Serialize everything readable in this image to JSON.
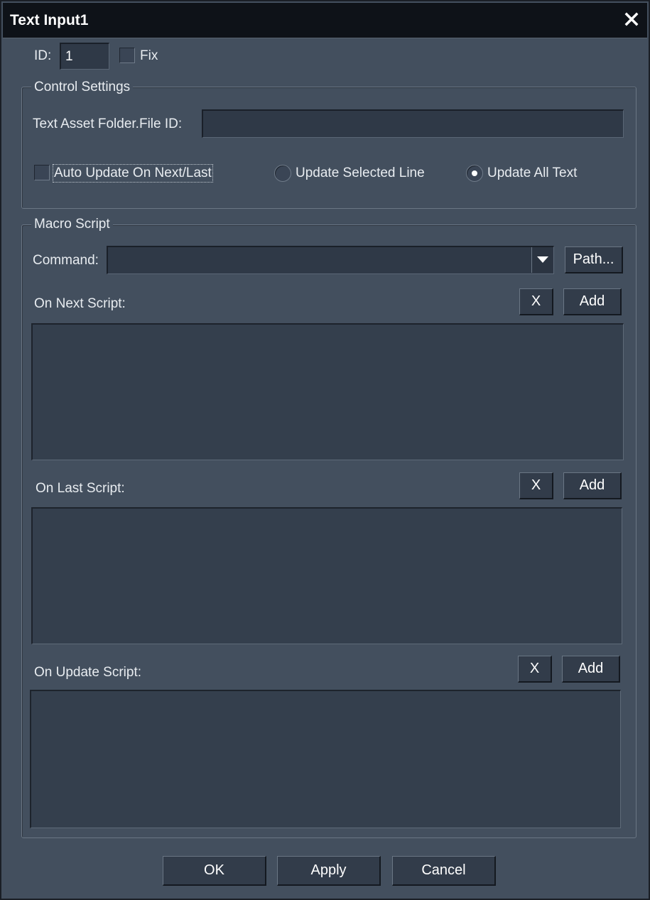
{
  "window": {
    "title": "Text Input1",
    "close_icon": "close-icon"
  },
  "id_row": {
    "id_label": "ID:",
    "id_value": "1",
    "fix_label": "Fix",
    "fix_checked": false
  },
  "control_settings": {
    "title": "Control Settings",
    "asset_label": "Text Asset Folder.File ID:",
    "asset_value": "",
    "auto_update_label": "Auto Update On Next/Last",
    "auto_update_checked": false,
    "radio_selected_line_label": "Update Selected Line",
    "radio_all_text_label": "Update All Text",
    "selected_radio": "Update All Text"
  },
  "macro_script": {
    "title": "Macro Script",
    "command_label": "Command:",
    "command_value": "",
    "path_button": "Path...",
    "sections": [
      {
        "label": "On Next Script:",
        "clear_button": "X",
        "add_button": "Add",
        "content": ""
      },
      {
        "label": "On Last Script:",
        "clear_button": "X",
        "add_button": "Add",
        "content": ""
      },
      {
        "label": "On Update Script:",
        "clear_button": "X",
        "add_button": "Add",
        "content": ""
      }
    ]
  },
  "footer": {
    "ok": "OK",
    "apply": "Apply",
    "cancel": "Cancel"
  },
  "colors": {
    "window_bg": "#434f5e",
    "titlebar_bg": "#0e1218",
    "field_bg": "#2f3947",
    "button_bg": "#323c4a"
  }
}
